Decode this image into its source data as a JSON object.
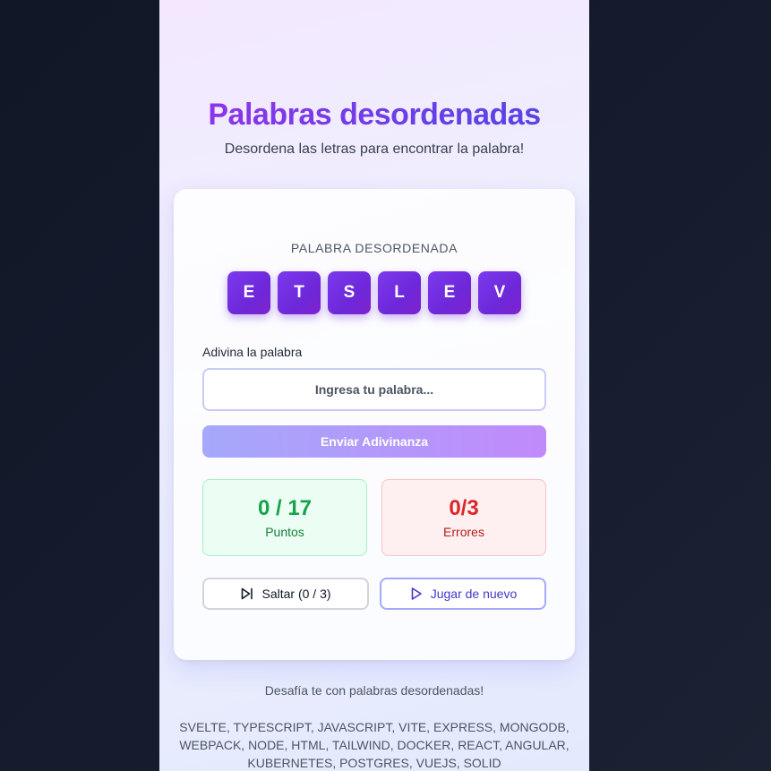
{
  "header": {
    "title": "Palabras desordenadas",
    "subtitle": "Desordena las letras para encontrar la palabra!"
  },
  "game": {
    "scrambled_label": "PALABRA DESORDENADA",
    "letters": [
      "E",
      "T",
      "S",
      "L",
      "E",
      "V"
    ],
    "guess_label": "Adivina la palabra",
    "guess_placeholder": "Ingresa tu palabra...",
    "guess_value": "",
    "submit_label": "Enviar Adivinanza"
  },
  "stats": {
    "score_value": "0 / 17",
    "score_label": "Puntos",
    "errors_value": "0/3",
    "errors_label": "Errores"
  },
  "actions": {
    "skip_label": "Saltar (0 / 3)",
    "skip_icon": "skip-forward-icon",
    "replay_label": "Jugar de nuevo",
    "replay_icon": "play-icon"
  },
  "footer": {
    "tagline": "Desafía te con palabras desordenadas!",
    "word_list": "SVELTE, TYPESCRIPT, JAVASCRIPT, VITE, EXPRESS, MONGODB, WEBPACK, NODE, HTML, TAILWIND, DOCKER, REACT, ANGULAR, KUBERNETES, POSTGRES, VUEJS, SOLID"
  },
  "colors": {
    "accent_purple": "#7c3aed",
    "accent_indigo": "#4f46e5",
    "success": "#16a34a",
    "danger": "#dc2626"
  }
}
